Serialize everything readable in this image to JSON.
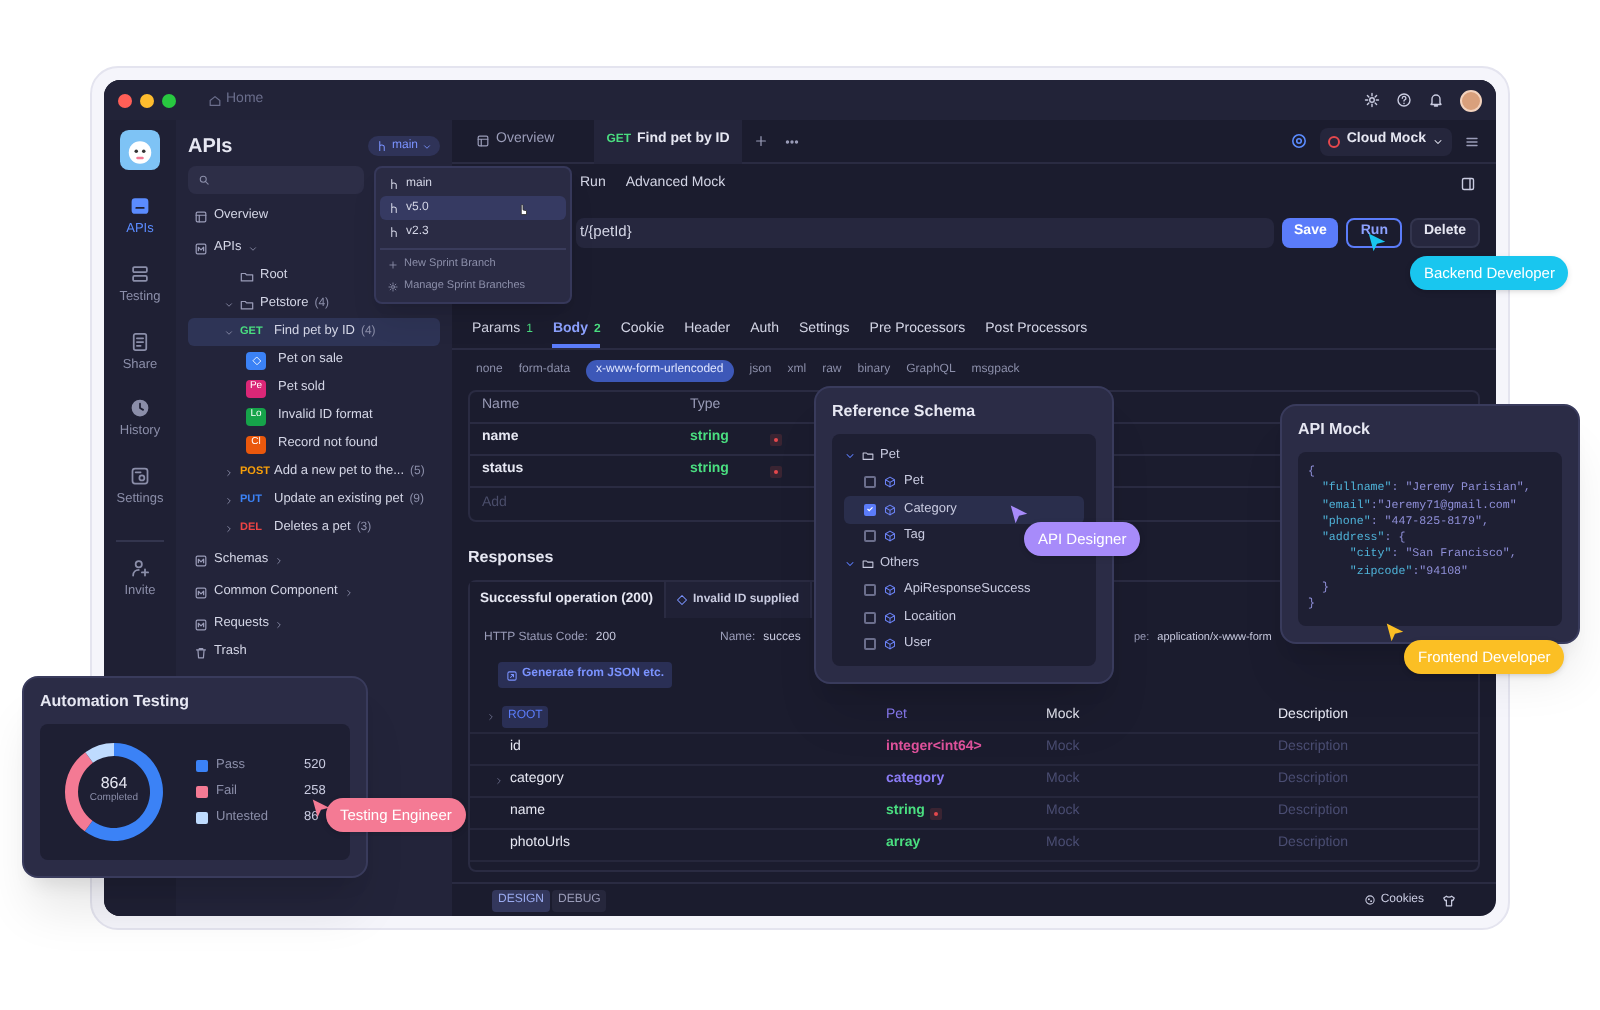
{
  "window": {
    "breadcrumb": "Home"
  },
  "rail": [
    {
      "label": "APIs",
      "kind": "api",
      "selected": true
    },
    {
      "label": "Testing",
      "kind": "testing",
      "selected": false
    },
    {
      "label": "Share",
      "kind": "share",
      "selected": false
    },
    {
      "label": "History",
      "kind": "history",
      "selected": false
    },
    {
      "label": "Settings",
      "kind": "settings",
      "selected": false
    }
  ],
  "invite": "Invite",
  "sidebar": {
    "title": "APIs",
    "branch": "main",
    "tree": [
      {
        "kind": "page",
        "label": "Overview",
        "selected": false
      },
      {
        "kind": "module",
        "label": "APIs",
        "expanded": true,
        "selected": false,
        "children": [
          {
            "kind": "folder",
            "label": "Root",
            "selected": false
          },
          {
            "kind": "folder",
            "label": "Petstore",
            "count": "(4)",
            "expanded": true,
            "selected": false,
            "children": [
              {
                "kind": "endpoint",
                "method": "GET",
                "color": "#4ade80",
                "label": "Find pet by ID",
                "count": "(4)",
                "expanded": true,
                "selected": true,
                "children": [
                  {
                    "kind": "case",
                    "label": "Pet on sale",
                    "color": "#3b82f6",
                    "selected": false
                  },
                  {
                    "kind": "case",
                    "badge": "Pe",
                    "label": "Pet sold",
                    "color": "#db2777",
                    "selected": false
                  },
                  {
                    "kind": "case",
                    "badge": "Lo",
                    "label": "Invalid ID format",
                    "color": "#16a34a",
                    "selected": false
                  },
                  {
                    "kind": "case",
                    "badge": "Cl",
                    "label": "Record not found",
                    "color": "#ea580c",
                    "selected": false
                  }
                ]
              },
              {
                "kind": "endpoint",
                "method": "POST",
                "color": "#f59e0b",
                "label": "Add a new pet to the...",
                "count": "(5)",
                "expanded": false,
                "selected": false
              },
              {
                "kind": "endpoint",
                "method": "PUT",
                "color": "#3b82f6",
                "label": "Update an existing pet",
                "count": "(9)",
                "expanded": false,
                "selected": false
              },
              {
                "kind": "endpoint",
                "method": "DEL",
                "color": "#ef4444",
                "label": "Deletes a pet",
                "count": "(3)",
                "expanded": false,
                "selected": false
              }
            ]
          }
        ]
      },
      {
        "kind": "module",
        "label": "Schemas",
        "expanded": false,
        "selected": false
      },
      {
        "kind": "module",
        "label": "Common Component",
        "expanded": false,
        "selected": false
      },
      {
        "kind": "module",
        "label": "Requests",
        "expanded": false,
        "selected": false
      },
      {
        "kind": "trash",
        "label": "Trash",
        "selected": false
      }
    ]
  },
  "branch_menu": {
    "branches": [
      {
        "label": "main",
        "selected": false
      },
      {
        "label": "v5.0",
        "selected": true
      },
      {
        "label": "v2.3",
        "selected": false
      }
    ],
    "actions": [
      {
        "kind": "add",
        "label": "New Sprint Branch"
      },
      {
        "kind": "manage",
        "label": "Manage Sprint Branches"
      }
    ]
  },
  "editor_tabs": [
    {
      "kind": "page",
      "label": "Overview",
      "selected": false
    },
    {
      "kind": "endpoint",
      "method": "GET",
      "label": "Find pet by ID",
      "selected": true
    }
  ],
  "mock_env": "Cloud Mock",
  "sub_tabs": [
    {
      "label": "Run",
      "selected": false
    },
    {
      "label": "Advanced Mock",
      "selected": false
    }
  ],
  "url": "t/{petId}",
  "actions": [
    {
      "kind": "primary",
      "label": "Save"
    },
    {
      "kind": "outline",
      "label": "Run"
    },
    {
      "kind": "plain",
      "label": "Delete"
    }
  ],
  "param_tabs": [
    {
      "label": "Params",
      "count": "1",
      "selected": false
    },
    {
      "label": "Body",
      "count": "2",
      "selected": true
    },
    {
      "label": "Cookie",
      "selected": false
    },
    {
      "label": "Header",
      "selected": false
    },
    {
      "label": "Auth",
      "selected": false
    },
    {
      "label": "Settings",
      "selected": false
    },
    {
      "label": "Pre Processors",
      "selected": false
    },
    {
      "label": "Post Processors",
      "selected": false
    }
  ],
  "body_types": [
    {
      "label": "none",
      "selected": false
    },
    {
      "label": "form-data",
      "selected": false
    },
    {
      "label": "x-www-form-urlencoded",
      "selected": true
    },
    {
      "label": "json",
      "selected": false
    },
    {
      "label": "xml",
      "selected": false
    },
    {
      "label": "raw",
      "selected": false
    },
    {
      "label": "binary",
      "selected": false
    },
    {
      "label": "GraphQL",
      "selected": false
    },
    {
      "label": "msgpack",
      "selected": false
    }
  ],
  "params": {
    "columns": [
      "Name",
      "Type"
    ],
    "rows": [
      {
        "name": "name",
        "type": "string",
        "required": true
      },
      {
        "name": "status",
        "type": "string",
        "required": true
      }
    ],
    "add": "Add"
  },
  "responses": {
    "title": "Responses",
    "tabs": [
      {
        "label": "Successful operation (200)",
        "selected": true
      },
      {
        "label": "Invalid ID supplied",
        "selected": false
      }
    ],
    "status_label": "HTTP Status Code:",
    "status": "200",
    "name_label": "Name:",
    "name": "succes",
    "type_label": "pe:",
    "type": "application/x-www-form",
    "generate": "Generate from JSON etc.",
    "columns": [
      "ROOT",
      "Pet",
      "Mock",
      "Description"
    ],
    "rows": [
      {
        "name": "id",
        "type": "integer<int64>",
        "color": "#e0529c",
        "mock": "Mock",
        "description": "Description"
      },
      {
        "name": "category",
        "expanded": false,
        "type": "category",
        "color": "#8b7cf6",
        "mock": "Mock",
        "description": "Description"
      },
      {
        "name": "name",
        "type": "string",
        "required": true,
        "color": "#4ade80",
        "mock": "Mock",
        "description": "Description"
      },
      {
        "name": "photoUrls",
        "type": "array",
        "color": "#4ade80",
        "mock": "Mock",
        "description": "Description"
      }
    ]
  },
  "bottom": {
    "tabs": [
      {
        "label": "DESIGN",
        "selected": true
      },
      {
        "label": "DEBUG",
        "selected": false
      }
    ],
    "cookies": "Cookies"
  },
  "schema_card": {
    "title": "Reference Schema",
    "groups": [
      {
        "label": "Pet",
        "expanded": true,
        "items": [
          {
            "label": "Pet",
            "checked": false,
            "selected": false
          },
          {
            "label": "Category",
            "checked": true,
            "selected": true
          },
          {
            "label": "Tag",
            "checked": false,
            "selected": false
          }
        ]
      },
      {
        "label": "Others",
        "expanded": true,
        "items": [
          {
            "label": "ApiResponseSuccess",
            "checked": false,
            "selected": false
          },
          {
            "label": "Locaition",
            "checked": false,
            "selected": false
          },
          {
            "label": "User",
            "checked": false,
            "selected": false
          }
        ]
      }
    ]
  },
  "mock_card": {
    "title": "API Mock",
    "lines": [
      "{",
      "  \"fullname\": \"Jeremy Parisian\",",
      "  \"email\":\"Jeremy71@gmail.com\"",
      "  \"phone\": \"447-825-8179\",",
      "  \"address\": {",
      "      \"city\": \"San Francisco\",",
      "      \"zipcode\":\"94108\"",
      "  }",
      "}"
    ]
  },
  "testing_card": {
    "title": "Automation Testing",
    "total": "864",
    "total_label": "Completed",
    "legend": [
      {
        "value": "520",
        "color": "#3b82f6"
      },
      {
        "value": "258",
        "color": "#f47a94"
      },
      {
        "value": "86",
        "color": "#bfdbfe"
      }
    ],
    "chart_data": {
      "type": "donut",
      "categories": [
        "Pass",
        "Fail",
        "Untested"
      ],
      "values": [
        60.19,
        29.86,
        9.95
      ]
    }
  },
  "tags": [
    {
      "label": "Backend Developer",
      "color": "#19c6ef"
    },
    {
      "label": "API Designer",
      "color": "#a78bfa"
    },
    {
      "label": "Frontend Developer",
      "color": "#fbbf24"
    },
    {
      "label": "Testing Engineer",
      "color": "#f47a94"
    }
  ]
}
